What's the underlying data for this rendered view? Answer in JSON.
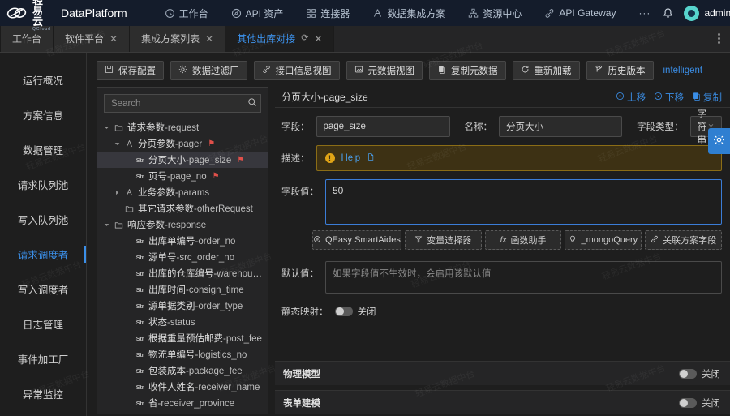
{
  "header": {
    "brand_cn": "轻易云",
    "brand_sub": "QCloud",
    "brand_name": "DataPlatform",
    "nav": [
      {
        "label": "工作台",
        "icon": "clock-icon"
      },
      {
        "label": "API 资产",
        "icon": "compass-icon"
      },
      {
        "label": "连接器",
        "icon": "grid-icon"
      },
      {
        "label": "数据集成方案",
        "icon": "people-icon"
      },
      {
        "label": "资源中心",
        "icon": "sitemap-icon"
      },
      {
        "label": "API Gateway",
        "icon": "link-icon"
      }
    ],
    "more": "···",
    "bell_icon": "bell-icon",
    "user": "admin"
  },
  "tabs": [
    {
      "label": "工作台",
      "closable": false,
      "active": false,
      "refresh": false
    },
    {
      "label": "软件平台",
      "closable": true,
      "active": false,
      "refresh": false
    },
    {
      "label": "集成方案列表",
      "closable": true,
      "active": false,
      "refresh": false
    },
    {
      "label": "其他出库对接",
      "closable": true,
      "active": true,
      "refresh": true
    }
  ],
  "tab_close_glyph": "✕",
  "tab_refresh_glyph": "⟳",
  "sidebar": {
    "items": [
      {
        "label": "运行概况",
        "active": false
      },
      {
        "label": "方案信息",
        "active": false
      },
      {
        "label": "数据管理",
        "active": false
      },
      {
        "label": "请求队列池",
        "active": false
      },
      {
        "label": "写入队列池",
        "active": false
      },
      {
        "label": "请求调度者",
        "active": true
      },
      {
        "label": "写入调度者",
        "active": false
      },
      {
        "label": "日志管理",
        "active": false
      },
      {
        "label": "事件加工厂",
        "active": false
      },
      {
        "label": "异常监控",
        "active": false
      }
    ]
  },
  "toolbar": {
    "buttons": [
      {
        "label": "保存配置",
        "icon": "save-icon"
      },
      {
        "label": "数据过滤厂",
        "icon": "gear-icon"
      },
      {
        "label": "接口信息视图",
        "icon": "link-icon"
      },
      {
        "label": "元数据视图",
        "icon": "image-icon"
      },
      {
        "label": "复制元数据",
        "icon": "copy-icon"
      },
      {
        "label": "重新加载",
        "icon": "refresh-icon"
      },
      {
        "label": "历史版本",
        "icon": "branch-icon"
      }
    ],
    "link": "intelligent"
  },
  "tree_panel": {
    "search_placeholder": "Search",
    "search_value": "",
    "search_icon": "search-icon",
    "nodes": [
      {
        "cn": "请求参数",
        "en": "-request",
        "indent": 0,
        "caret": "down",
        "icon": "folder",
        "flag": false,
        "selected": false
      },
      {
        "cn": "分页参数",
        "en": "-pager",
        "indent": 1,
        "caret": "down",
        "icon": "group",
        "flag": true,
        "selected": false
      },
      {
        "cn": "分页大小",
        "en": "-page_size",
        "indent": 2,
        "caret": "none",
        "icon": "str",
        "flag": true,
        "selected": true
      },
      {
        "cn": "页号",
        "en": "-page_no",
        "indent": 2,
        "caret": "none",
        "icon": "str",
        "flag": true,
        "selected": false
      },
      {
        "cn": "业务参数",
        "en": "-params",
        "indent": 1,
        "caret": "right",
        "icon": "group",
        "flag": false,
        "selected": false
      },
      {
        "cn": "其它请求参数",
        "en": "-otherRequest",
        "indent": 1,
        "caret": "none",
        "icon": "folder",
        "flag": false,
        "selected": false
      },
      {
        "cn": "响应参数",
        "en": "-response",
        "indent": 0,
        "caret": "down",
        "icon": "folder",
        "flag": false,
        "selected": false
      },
      {
        "cn": "出库单编号",
        "en": "-order_no",
        "indent": 2,
        "caret": "none",
        "icon": "str",
        "flag": false,
        "selected": false
      },
      {
        "cn": "源单号",
        "en": "-src_order_no",
        "indent": 2,
        "caret": "none",
        "icon": "str",
        "flag": false,
        "selected": false
      },
      {
        "cn": "出库的仓库编号",
        "en": "-warehouse_no",
        "indent": 2,
        "caret": "none",
        "icon": "str",
        "flag": false,
        "selected": false
      },
      {
        "cn": "出库时间",
        "en": "-consign_time",
        "indent": 2,
        "caret": "none",
        "icon": "str",
        "flag": false,
        "selected": false
      },
      {
        "cn": "源单据类别",
        "en": "-order_type",
        "indent": 2,
        "caret": "none",
        "icon": "str",
        "flag": false,
        "selected": false
      },
      {
        "cn": "状态",
        "en": "-status",
        "indent": 2,
        "caret": "none",
        "icon": "str",
        "flag": false,
        "selected": false
      },
      {
        "cn": "根据重量预估邮费",
        "en": "-post_fee",
        "indent": 2,
        "caret": "none",
        "icon": "str",
        "flag": false,
        "selected": false
      },
      {
        "cn": "物流单编号",
        "en": "-logistics_no",
        "indent": 2,
        "caret": "none",
        "icon": "str",
        "flag": false,
        "selected": false
      },
      {
        "cn": "包装成本",
        "en": "-package_fee",
        "indent": 2,
        "caret": "none",
        "icon": "str",
        "flag": false,
        "selected": false
      },
      {
        "cn": "收件人姓名",
        "en": "-receiver_name",
        "indent": 2,
        "caret": "none",
        "icon": "str",
        "flag": false,
        "selected": false
      },
      {
        "cn": "省",
        "en": "-receiver_province",
        "indent": 2,
        "caret": "none",
        "icon": "str",
        "flag": false,
        "selected": false
      }
    ]
  },
  "detail": {
    "title": "分页大小-page_size",
    "actions": [
      {
        "label": "上移",
        "icon": "arrow-up-circle-icon"
      },
      {
        "label": "下移",
        "icon": "arrow-down-circle-icon"
      },
      {
        "label": "复制",
        "icon": "copy-icon"
      }
    ],
    "field_label": "字段：",
    "field_value": "page_size",
    "name_label": "名称：",
    "name_value": "分页大小",
    "type_label": "字段类型：",
    "type_value": "字符串",
    "type_caret": "chevron-down-icon",
    "desc_label": "描述：",
    "desc_warn_glyph": "!",
    "desc_help": "Help",
    "desc_help_icon": "doc-icon",
    "value_label": "字段值：",
    "value_text": "50",
    "helper_buttons": [
      {
        "label": "QEasy SmartAides",
        "icon": "robot-icon"
      },
      {
        "label": "变量选择器",
        "icon": "filter-icon"
      },
      {
        "label": "函数助手",
        "icon": "fx-icon"
      },
      {
        "label": "_mongoQuery",
        "icon": "bulb-icon"
      },
      {
        "label": "关联方案字段",
        "icon": "link-icon"
      }
    ],
    "default_label": "默认值：",
    "default_placeholder": "如果字段值不生效时，会启用该默认值",
    "default_value": "",
    "static_map_label": "静态映射：",
    "static_map_state": "关闭",
    "sections": [
      {
        "title": "物理模型",
        "state": "关闭"
      },
      {
        "title": "表单建模",
        "state": "关闭"
      }
    ]
  },
  "watermark": "轻易云数据中台",
  "colors": {
    "accent": "#3b8fe8",
    "header_bg": "#141c2b",
    "panel_bg": "#252526",
    "page_bg": "#1e1e1e",
    "warn_bg": "#3d3114",
    "flag_red": "#e0504a",
    "avatar": "#57d4cd"
  }
}
